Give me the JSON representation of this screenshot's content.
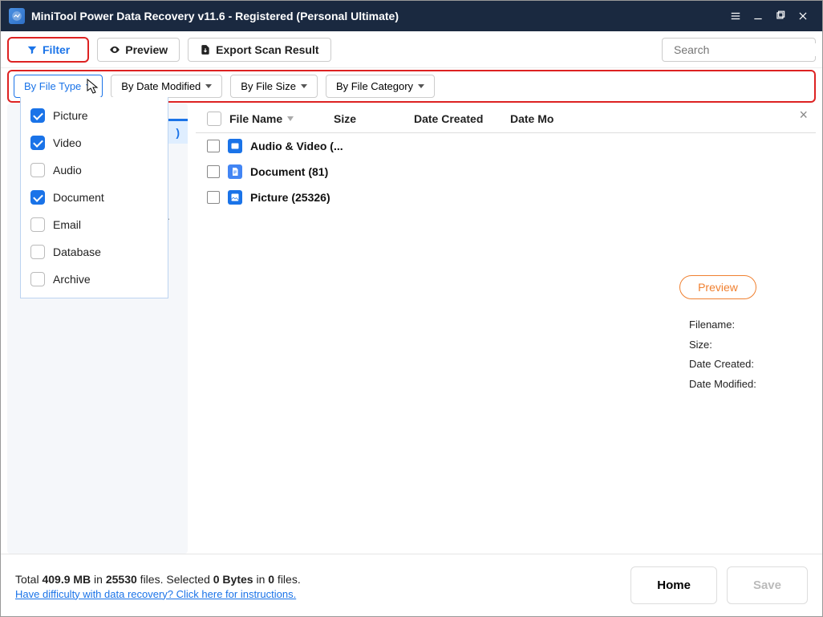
{
  "title": "MiniTool Power Data Recovery v11.6 - Registered (Personal Ultimate)",
  "toolbar": {
    "filter": "Filter",
    "preview": "Preview",
    "export": "Export Scan Result",
    "search_placeholder": "Search"
  },
  "filterbar": {
    "by_type": "By File Type",
    "by_date": "By Date Modified",
    "by_size": "By File Size",
    "by_category": "By File Category"
  },
  "filetype_options": [
    {
      "label": "Picture",
      "checked": true
    },
    {
      "label": "Video",
      "checked": true
    },
    {
      "label": "Audio",
      "checked": false
    },
    {
      "label": "Document",
      "checked": true
    },
    {
      "label": "Email",
      "checked": false
    },
    {
      "label": "Database",
      "checked": false
    },
    {
      "label": "Archive",
      "checked": false
    }
  ],
  "sidebar_tab_fragment": ")",
  "ellipsis": "..",
  "columns": {
    "check": "",
    "name": "File Name",
    "size": "Size",
    "created": "Date Created",
    "modified": "Date Mo"
  },
  "rows": [
    {
      "kind": "av",
      "label": "Audio & Video (..."
    },
    {
      "kind": "doc",
      "label": "Document (81)"
    },
    {
      "kind": "pic",
      "label": "Picture (25326)"
    }
  ],
  "detail": {
    "preview_btn": "Preview",
    "filename_lbl": "Filename:",
    "size_lbl": "Size:",
    "created_lbl": "Date Created:",
    "modified_lbl": "Date Modified:"
  },
  "status": {
    "total_prefix": "Total ",
    "total_size": "409.9 MB",
    "in1": " in ",
    "total_files": "25530",
    "files_word": " files. ",
    "selected_prefix": "Selected ",
    "sel_bytes": "0 Bytes",
    "in2": " in ",
    "sel_files": "0",
    "files_word2": " files.",
    "help": "Have difficulty with data recovery? Click here for instructions.",
    "home": "Home",
    "save": "Save"
  }
}
